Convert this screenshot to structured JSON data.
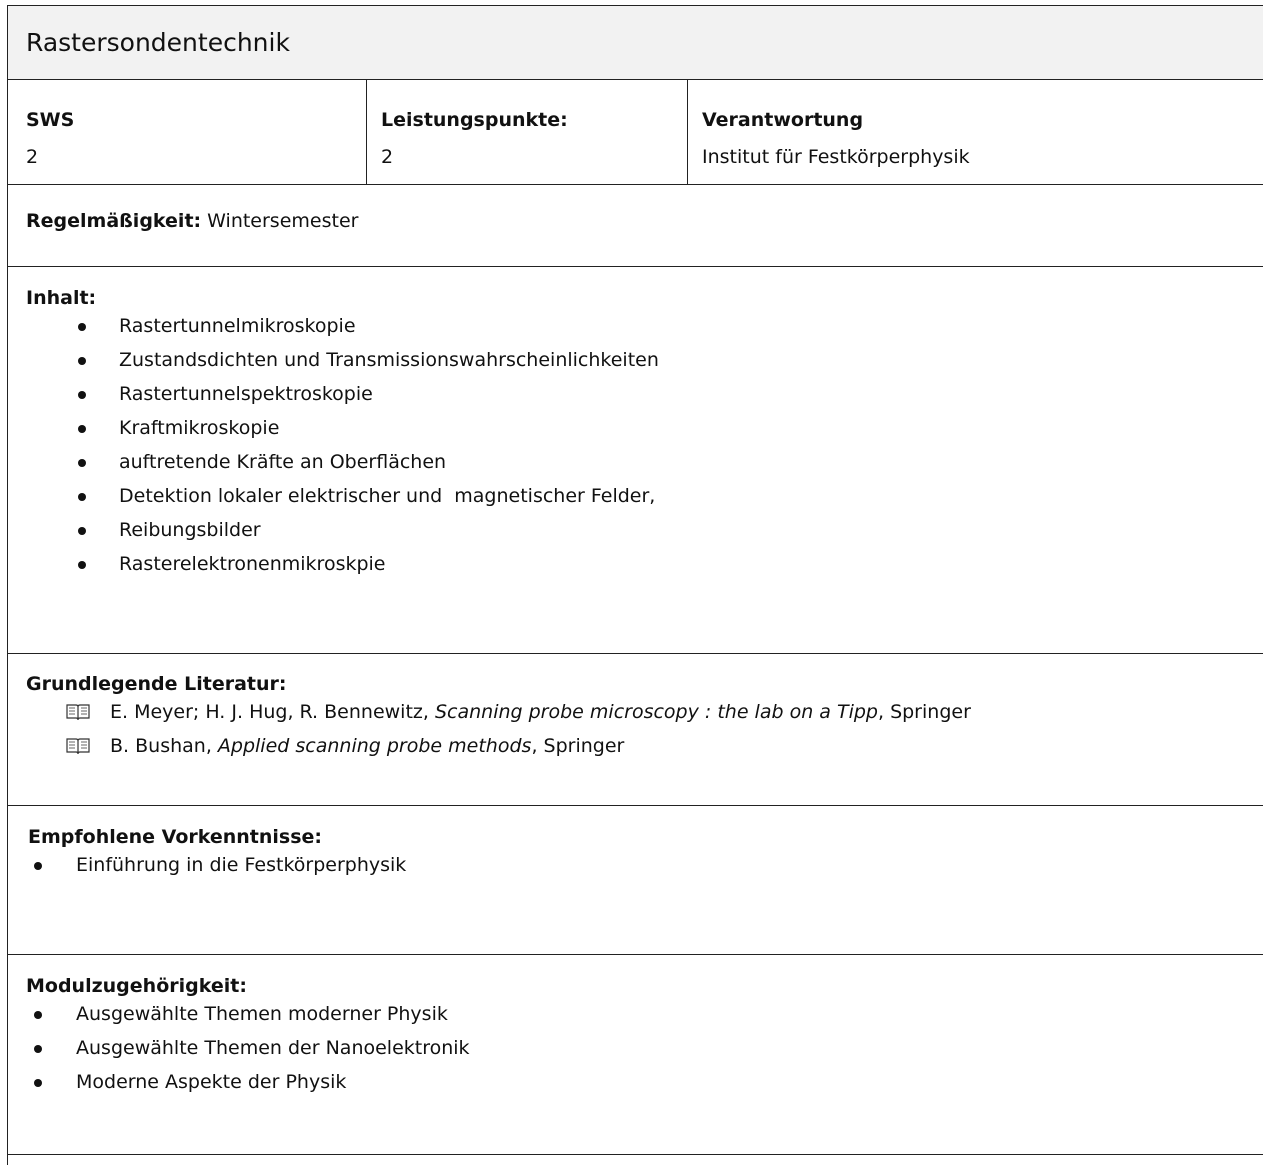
{
  "title": "Rastersondentechnik",
  "meta": {
    "sws_label": "SWS",
    "sws_value": "2",
    "lp_label": "Leistungspunkte:",
    "lp_value": "2",
    "resp_label": "Verantwortung",
    "resp_value": "Institut für Festkörperphysik"
  },
  "regel": {
    "label": "Regelmäßigkeit:",
    "value": " Wintersemester"
  },
  "inhalt": {
    "label": "Inhalt:",
    "items": [
      "Rastertunnelmikroskopie",
      "Zustandsdichten und Transmissionswahrscheinlichkeiten",
      "Rastertunnelspektroskopie",
      "Kraftmikroskopie",
      "auftretende Kräfte an Oberflächen",
      "Detektion lokaler elektrischer und  magnetischer Felder,",
      "Reibungsbilder",
      "Rasterelektronenmikroskpie"
    ]
  },
  "literatur": {
    "label": "Grundlegende Literatur:",
    "entries": [
      {
        "authors": "E. Meyer; H. J. Hug, R. Bennewitz, ",
        "title": "Scanning probe microscopy : the lab on a Tipp",
        "publisher": ", Springer"
      },
      {
        "authors": "B. Bushan, ",
        "title": "Applied scanning probe methods",
        "publisher": ", Springer"
      }
    ],
    "icon": "book-icon"
  },
  "vorkenntnisse": {
    "label": "Empfohlene Vorkenntnisse:",
    "items": [
      "Einführung in die Festkörperphysik"
    ]
  },
  "modul": {
    "label": "Modulzugehörigkeit:",
    "items": [
      "Ausgewählte Themen moderner Physik",
      "Ausgewählte Themen der Nanoelektronik",
      "Moderne Aspekte der Physik"
    ]
  }
}
